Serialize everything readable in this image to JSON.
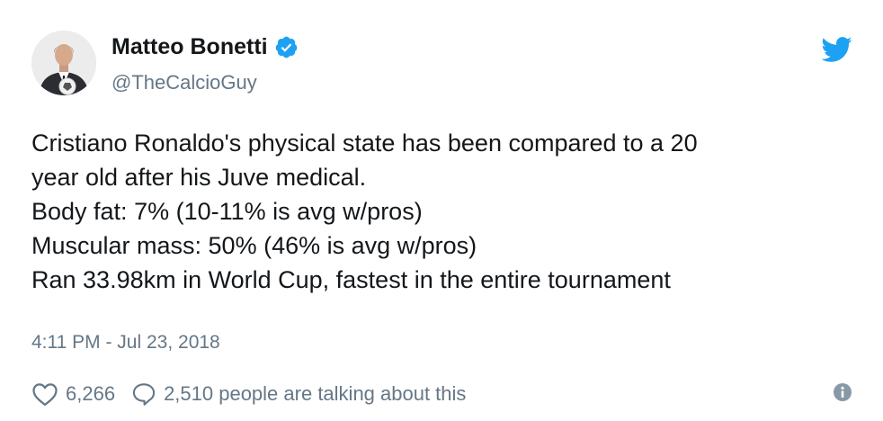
{
  "author": {
    "display_name": "Matteo Bonetti",
    "handle": "@TheCalcioGuy",
    "verified": true
  },
  "tweet": {
    "lines": [
      "Cristiano Ronaldo's physical state has been compared to a 20",
      "year old after his Juve medical.",
      "Body fat: 7% (10-11% is avg w/pros)",
      "Muscular mass: 50% (46% is avg w/pros)",
      "Ran 33.98km in World Cup, fastest in the entire tournament"
    ],
    "timestamp": "4:11 PM - Jul 23, 2018"
  },
  "actions": {
    "like_count": "6,266",
    "reply_text": "2,510 people are talking about this"
  },
  "icons": {
    "verified": "verified-badge-icon",
    "brand": "twitter-bird-icon",
    "like": "heart-icon",
    "reply": "speech-bubble-icon",
    "info": "info-icon"
  },
  "colors": {
    "brand_blue": "#1da1f2",
    "text_primary": "#14171a",
    "text_secondary": "#657786"
  }
}
